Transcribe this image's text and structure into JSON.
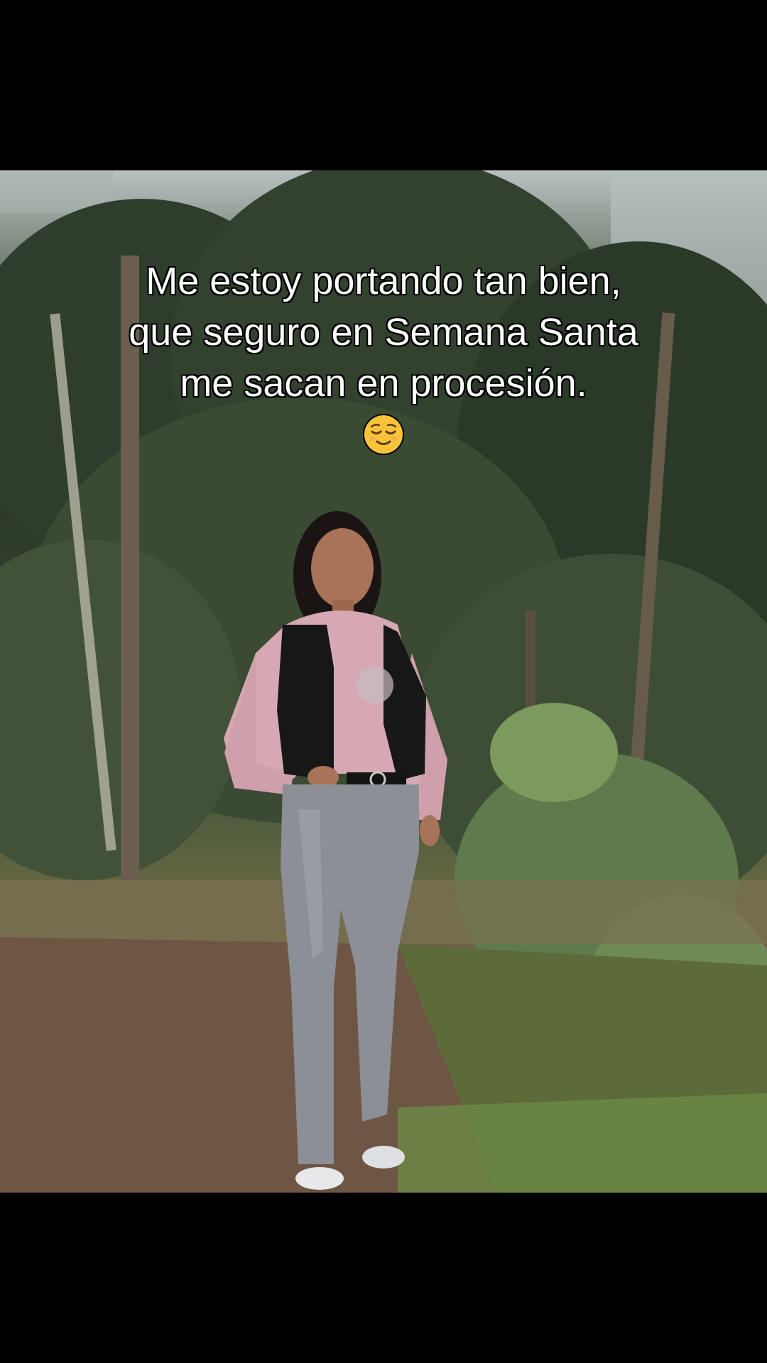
{
  "caption": {
    "line1": "Me estoy portando tan bien,",
    "line2": "que seguro en Semana Santa",
    "line3": "me sacan en procesión."
  },
  "emoji": {
    "icon": "relieved-face-emoji",
    "color": "#f7c33a"
  },
  "colors": {
    "background": "#000000",
    "caption_text": "#ffffff",
    "caption_outline": "#000000"
  }
}
